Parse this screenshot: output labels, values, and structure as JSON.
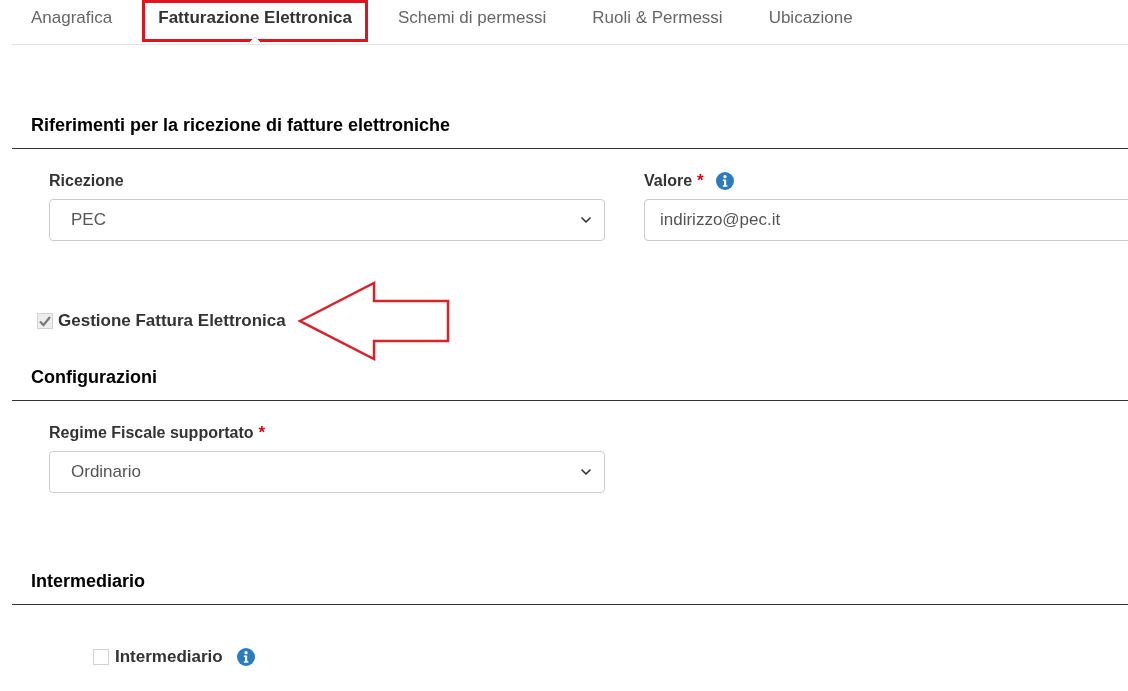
{
  "tabs": [
    {
      "label": "Anagrafica",
      "selected": false,
      "highlighted": false
    },
    {
      "label": "Fatturazione Elettronica",
      "selected": true,
      "highlighted": true
    },
    {
      "label": "Schemi di permessi",
      "selected": false,
      "highlighted": false
    },
    {
      "label": "Ruoli & Permessi",
      "selected": false,
      "highlighted": false
    },
    {
      "label": "Ubicazione",
      "selected": false,
      "highlighted": false
    }
  ],
  "sections": [
    {
      "title": "Riferimenti per la ricezione di fatture elettroniche",
      "fields": [
        {
          "kind": "select",
          "label": "Ricezione",
          "info": false,
          "value": "PEC"
        },
        {
          "kind": "text",
          "label": "Valore",
          "required_mark": "*",
          "info": true,
          "value": "indirizzo@pec.it"
        }
      ],
      "checkboxes": [
        {
          "kind": "inline",
          "label": "Gestione Fattura Elettronica",
          "checked": true,
          "info": false,
          "arrow": true
        }
      ]
    },
    {
      "title": "Configurazioni",
      "fields": [
        {
          "kind": "select",
          "label": "Regime Fiscale supportato",
          "required_mark": "*",
          "info": false,
          "value": "Ordinario"
        }
      ]
    },
    {
      "title": "Intermediario",
      "checkboxes": [
        {
          "kind": "field",
          "label": "Intermediario",
          "checked": false,
          "info": true,
          "arrow": false
        }
      ]
    }
  ]
}
